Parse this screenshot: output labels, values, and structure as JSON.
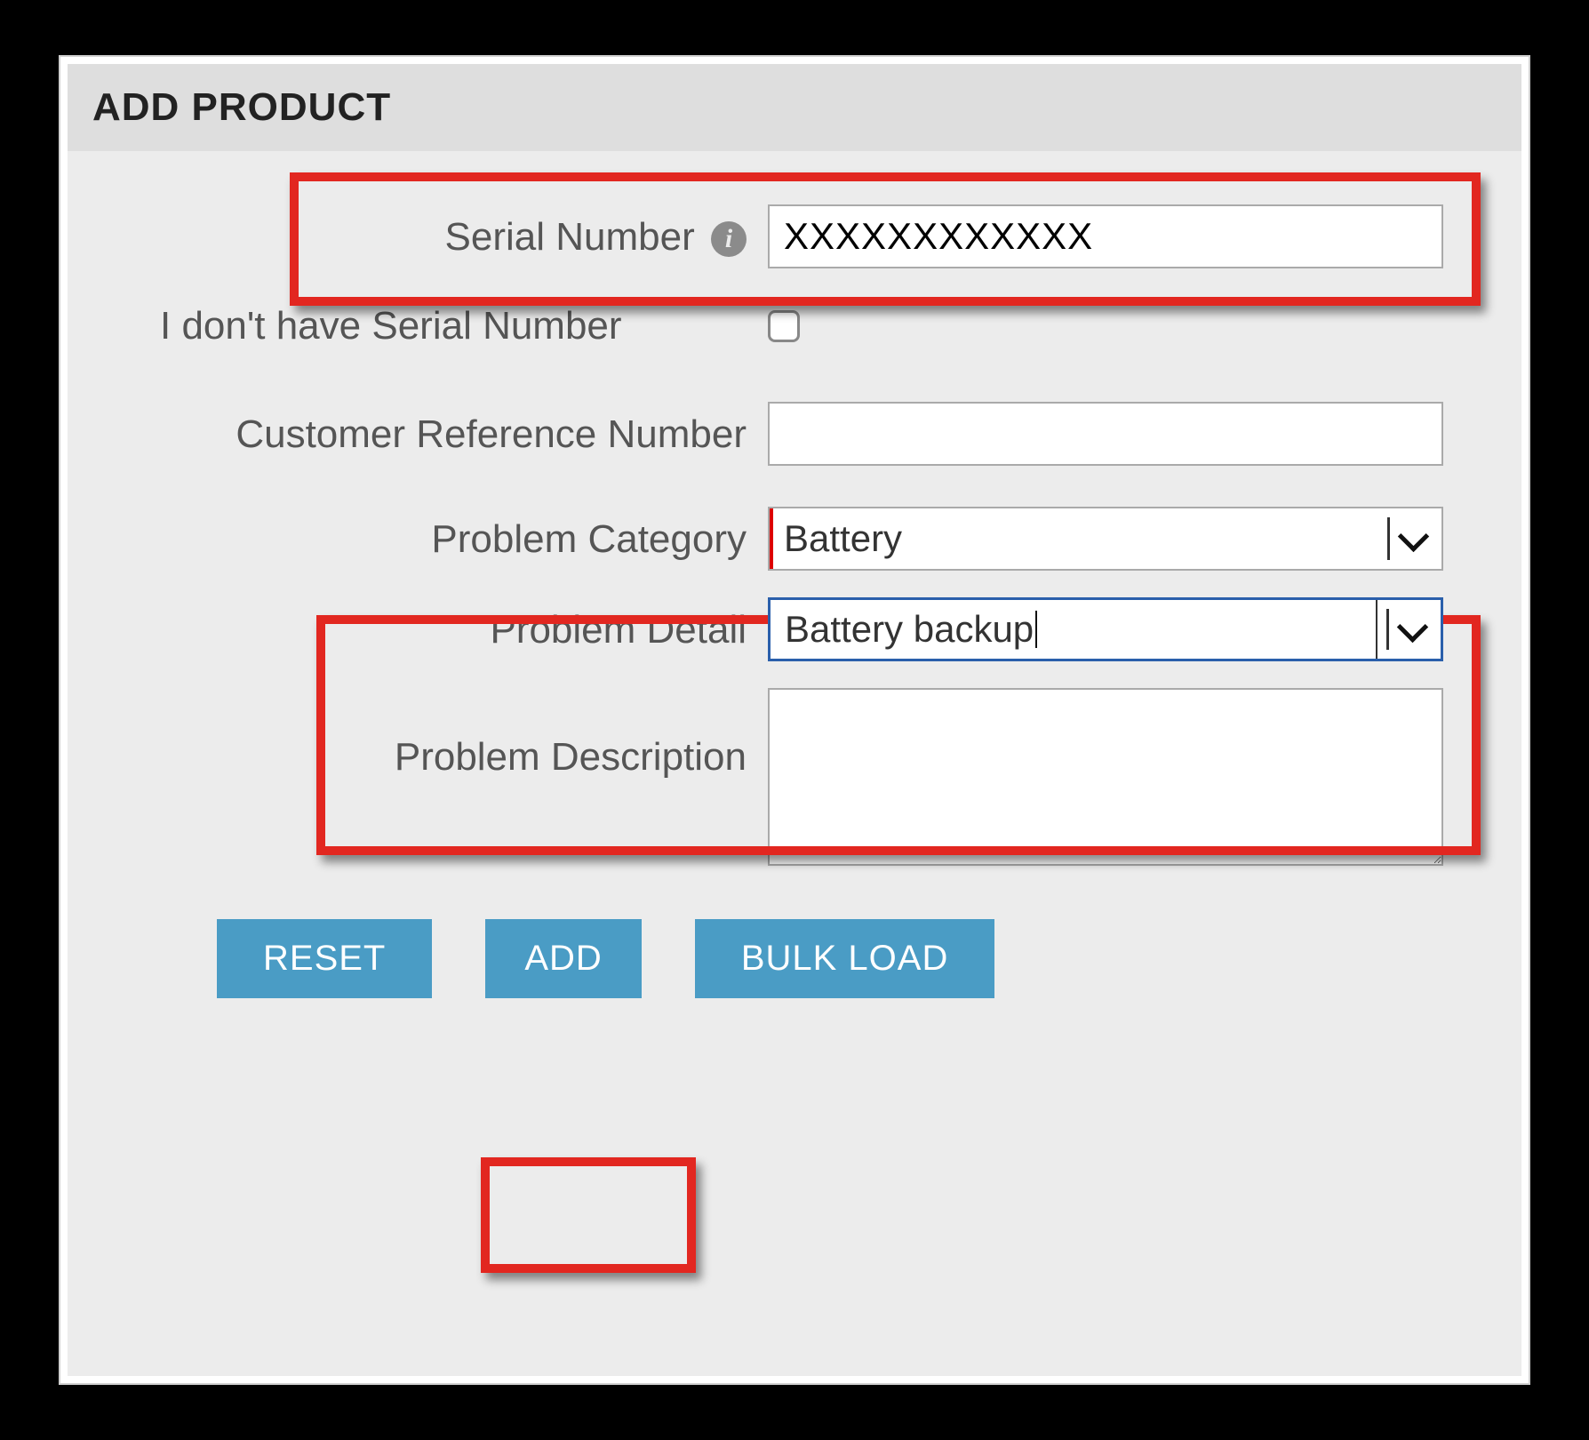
{
  "header": {
    "title": "ADD PRODUCT"
  },
  "form": {
    "serial_number": {
      "label": "Serial Number",
      "value": "XXXXXXXXXXXX"
    },
    "no_serial": {
      "label": "I don't have Serial Number",
      "checked": false
    },
    "customer_reference": {
      "label": "Customer Reference Number",
      "value": ""
    },
    "problem_category": {
      "label": "Problem Category",
      "value": "Battery"
    },
    "problem_detail": {
      "label": "Problem Detail",
      "value": "Battery backup"
    },
    "problem_description": {
      "label": "Problem Description",
      "value": ""
    }
  },
  "buttons": {
    "reset": "RESET",
    "add": "ADD",
    "bulk_load": "BULK LOAD"
  },
  "colors": {
    "button_bg": "#4a9cc5",
    "highlight": "#e22720",
    "panel_bg": "#ececec",
    "header_bg": "#dedede",
    "select_focus": "#2a5fab"
  }
}
